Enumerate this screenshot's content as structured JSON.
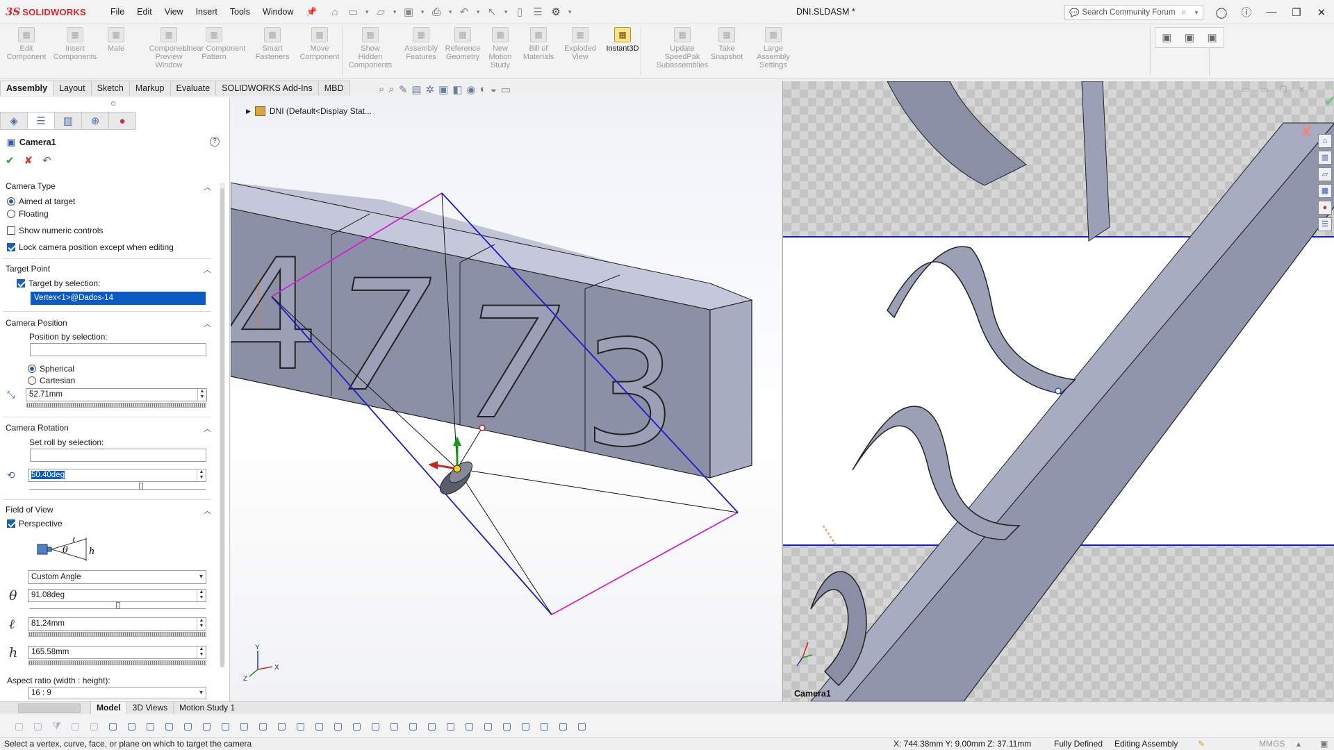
{
  "app": {
    "logo_ds": "3S",
    "logo_text": "SOLIDWORKS",
    "doc_title": "DNI.SLDASM *",
    "menu": [
      "File",
      "Edit",
      "View",
      "Insert",
      "Tools",
      "Window"
    ],
    "search_placeholder": "Search Community Forum"
  },
  "commands": [
    {
      "label": "Edit\nComponent",
      "icon": "edit-component-icon"
    },
    {
      "label": "Insert\nComponents",
      "icon": "insert-components-icon"
    },
    {
      "label": "Mate",
      "icon": "mate-icon"
    },
    {
      "label": "Component\nPreview\nWindow",
      "icon": "preview-icon"
    },
    {
      "label": "Linear Component\nPattern",
      "icon": "pattern-icon"
    },
    {
      "label": "Smart\nFasteners",
      "icon": "fastener-icon"
    },
    {
      "label": "Move\nComponent",
      "icon": "move-icon"
    },
    {
      "label": "Show\nHidden\nComponents",
      "icon": "show-hidden-icon"
    },
    {
      "label": "Assembly\nFeatures",
      "icon": "assembly-features-icon"
    },
    {
      "label": "Reference\nGeometry",
      "icon": "reference-geometry-icon"
    },
    {
      "label": "New\nMotion\nStudy",
      "icon": "motion-study-icon"
    },
    {
      "label": "Bill of\nMaterials",
      "icon": "bom-icon"
    },
    {
      "label": "Exploded\nView",
      "icon": "exploded-view-icon"
    },
    {
      "label": "Instant3D",
      "icon": "instant3d-icon"
    },
    {
      "label": "Update\nSpeedPak\nSubassemblies",
      "icon": "speedpak-icon"
    },
    {
      "label": "Take\nSnapshot",
      "icon": "snapshot-icon"
    },
    {
      "label": "Large\nAssembly\nSettings",
      "icon": "large-assembly-icon"
    }
  ],
  "tabs": [
    "Assembly",
    "Layout",
    "Sketch",
    "Markup",
    "Evaluate",
    "SOLIDWORKS Add-Ins",
    "MBD"
  ],
  "pm": {
    "title": "Camera1",
    "camera_type": {
      "header": "Camera Type",
      "aimed": "Aimed at target",
      "floating": "Floating",
      "show_numeric": "Show numeric controls",
      "lock_camera": "Lock camera position except when editing"
    },
    "target_point": {
      "header": "Target Point",
      "by_selection": "Target by selection:",
      "value": "Vertex<1>@Dados-14"
    },
    "camera_position": {
      "header": "Camera Position",
      "by_selection": "Position by selection:",
      "spherical": "Spherical",
      "cartesian": "Cartesian",
      "distance": "52.71mm"
    },
    "camera_rotation": {
      "header": "Camera Rotation",
      "roll_by_selection": "Set roll by selection:",
      "roll": "50.40deg"
    },
    "fov": {
      "header": "Field of View",
      "perspective": "Perspective",
      "preset": "Custom Angle",
      "theta": "91.08deg",
      "l": "81.24mm",
      "h": "165.58mm",
      "aspect_label": "Aspect ratio (width : height):",
      "aspect": "16 : 9"
    }
  },
  "tree": {
    "root": "DNI  (Default<Display Stat..."
  },
  "model_digits": [
    "4",
    "7",
    "7",
    "3"
  ],
  "right_view": {
    "label": "Camera1"
  },
  "bottom_tabs": [
    "Model",
    "3D Views",
    "Motion Study 1"
  ],
  "status": {
    "message": "Select a vertex, curve, face, or plane on which to target the camera",
    "coords": "X: 744.38mm Y: 9.00mm Z: 37.11mm",
    "defined": "Fully Defined",
    "mode": "Editing Assembly",
    "units": "MMGS"
  },
  "colors": {
    "selection_blue": "#0a5ac2",
    "frustum_blue": "#1a1acc",
    "frustum_magenta": "#d020d0",
    "model_gray": "#8a8fa6",
    "brand_red": "#d8232a"
  }
}
